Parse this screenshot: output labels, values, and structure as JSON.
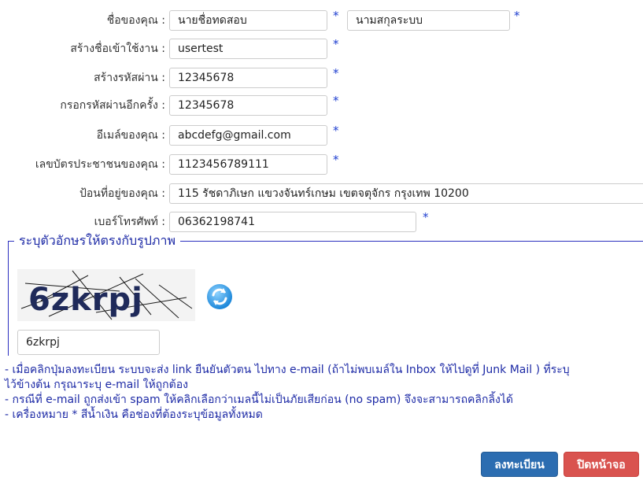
{
  "form": {
    "name": {
      "label": "ชื่อของคุณ :",
      "first_value": "นายชื่อทดสอบ",
      "last_value": "นามสกุลระบบ"
    },
    "username": {
      "label": "สร้างชื่อเข้าใช้งาน :",
      "value": "usertest"
    },
    "password": {
      "label": "สร้างรหัสผ่าน :",
      "value": "12345678"
    },
    "password_confirm": {
      "label": "กรอกรหัสผ่านอีกครั้ง :",
      "value": "12345678"
    },
    "email": {
      "label": "อีเมล์ของคุณ :",
      "value": "abcdefg@gmail.com"
    },
    "id_card": {
      "label": "เลขบัตรประชาชนของคุณ :",
      "value": "1123456789111"
    },
    "address": {
      "label": "ป้อนที่อยู่ของคุณ :",
      "value": "115 รัชดาภิเษก แขวงจันทร์เกษม เขตจตุจักร กรุงเทพ 10200"
    },
    "phone": {
      "label": "เบอร์โทรศัพท์ :",
      "value": "06362198741"
    },
    "required_mark": "*"
  },
  "captcha": {
    "legend": "ระบุตัวอักษรให้ตรงกับรูปภาพ",
    "image_text": "6zkrpj",
    "input_value": "6zkrpj",
    "refresh_icon": "refresh-icon"
  },
  "notes": [
    "- เมื่อคลิกปุ่มลงทะเบียน ระบบจะส่ง link ยืนยันตัวตน ไปทาง e-mail (ถ้าไม่พบเมล์ใน Inbox ให้ไปดูที่ Junk Mail ) ที่ระบุ",
    "ไว้ข้างต้น กรุณาระบุ e-mail ให้ถูกต้อง",
    "- กรณีที่ e-mail ถูกส่งเข้า spam ให้คลิกเลือกว่าเมลนี้ไม่เป็นภัยเสียก่อน (no spam) จึงจะสามารถคลิกลิ้งได้",
    "- เครื่องหมาย * สีน้ำเงิน คือช่องที่ต้องระบุข้อมูลทั้งหมด"
  ],
  "buttons": {
    "register": "ลงทะเบียน",
    "close": "ปิดหน้าจอ"
  },
  "colors": {
    "required": "#1f3fd0",
    "note_text": "#1d2aa6",
    "register_button": "#2c6db1",
    "close_button": "#d9534f"
  }
}
